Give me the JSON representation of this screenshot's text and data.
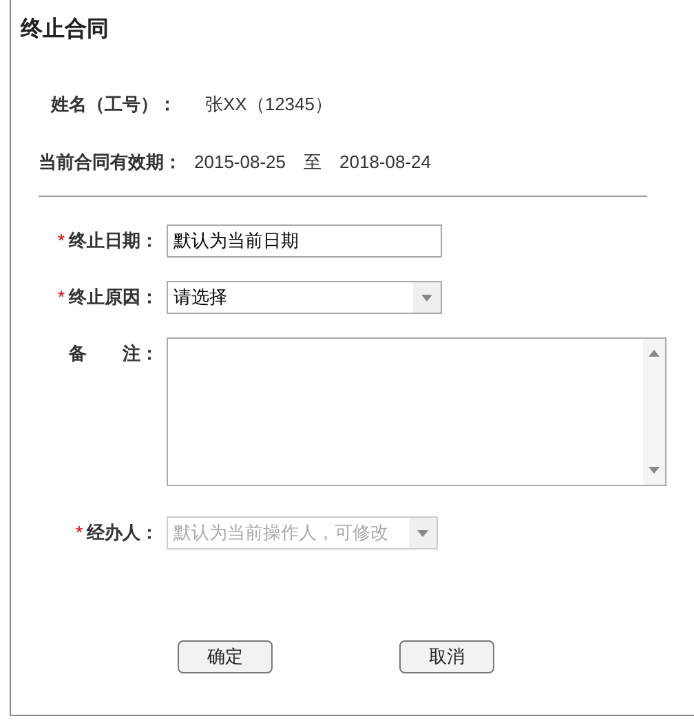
{
  "title": "终止合同",
  "info": [
    {
      "label": "姓名（工号）：",
      "value": "张XX（12345）"
    },
    {
      "label": "当前合同有效期：",
      "value": "2015-08-25",
      "separator": "至",
      "value2": "2018-08-24"
    }
  ],
  "fields": [
    {
      "kind": "text",
      "label": "终止日期：",
      "required_mark": "*",
      "value": "默认为当前日期"
    },
    {
      "kind": "select",
      "label": "终止原因：",
      "required_mark": "*",
      "value": "请选择"
    },
    {
      "kind": "textarea",
      "label": "备　　注："
    },
    {
      "kind": "combo",
      "label": "经办人：",
      "required_mark": "*",
      "placeholder": "默认为当前操作人，可修改"
    }
  ],
  "buttons": [
    "确定",
    "取消"
  ]
}
